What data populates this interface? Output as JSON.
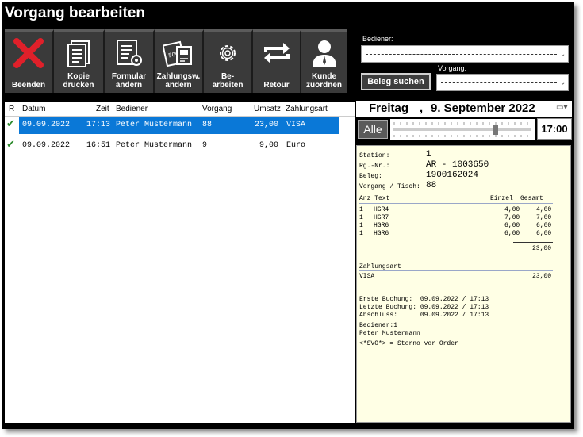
{
  "window": {
    "title": "Vorgang bearbeiten"
  },
  "toolbar": {
    "buttons": [
      {
        "label": "Beenden",
        "icon": "close-x-icon"
      },
      {
        "label": "Kopie\ndrucken",
        "icon": "document-copy-icon"
      },
      {
        "label": "Formular\nändern",
        "icon": "form-gear-icon"
      },
      {
        "label": "Zahlungsw.\nändern",
        "icon": "payment-method-icon"
      },
      {
        "label": "Be-\narbeiten",
        "icon": "gear-icon"
      },
      {
        "label": "Retour",
        "icon": "return-arrows-icon"
      },
      {
        "label": "Kunde\nzuordnen",
        "icon": "customer-icon"
      }
    ]
  },
  "filters": {
    "bediener_label": "Bediener:",
    "vorgang_label": "Vorgang:",
    "beleg_button": "Beleg suchen"
  },
  "table": {
    "headers": {
      "r": "R",
      "datum": "Datum",
      "zeit": "Zeit",
      "bediener": "Bediener",
      "vorgang": "Vorgang",
      "umsatz": "Umsatz",
      "zahlungsart": "Zahlungsart"
    },
    "rows": [
      {
        "datum": "09.09.2022",
        "zeit": "17:13",
        "bediener": "Peter Mustermann",
        "vorgang": "88",
        "umsatz": "23,00",
        "zahlungsart": "VISA"
      },
      {
        "datum": "09.09.2022",
        "zeit": "16:51",
        "bediener": "Peter Mustermann",
        "vorgang": "9",
        "umsatz": "9,00",
        "zahlungsart": "Euro"
      }
    ]
  },
  "date": {
    "weekday": "Freitag",
    "comma": ",",
    "date": "9. September 2022",
    "alle": "Alle",
    "time": "17:00"
  },
  "receipt": {
    "station_label": "Station:",
    "station_value": "1",
    "rgnr_label": "Rg.-Nr.:",
    "rgnr_value": "AR - 1003650",
    "beleg_label": "Beleg:",
    "beleg_value": "1900162024",
    "vorgang_label": "Vorgang / Tisch:",
    "vorgang_value": "88",
    "col_anz_text": "Anz Text",
    "col_einzel": "Einzel",
    "col_gesamt": "Gesamt",
    "items": [
      {
        "anz": "1",
        "text": "HGR4",
        "einzel": "4,00",
        "gesamt": "4,00"
      },
      {
        "anz": "1",
        "text": "HGR7",
        "einzel": "7,00",
        "gesamt": "7,00"
      },
      {
        "anz": "1",
        "text": "HGR6",
        "einzel": "6,00",
        "gesamt": "6,00"
      },
      {
        "anz": "1",
        "text": "HGR6",
        "einzel": "6,00",
        "gesamt": "6,00"
      }
    ],
    "total": "23,00",
    "zahlungsart_label": "Zahlungsart",
    "zahlungsart_value": "VISA",
    "zahlungsart_amount": "23,00",
    "erste_buchung": "Erste Buchung:  09.09.2022 / 17:13",
    "letzte_buchung": "Letzte Buchung: 09.09.2022 / 17:13",
    "abschluss": "Abschluss:      09.09.2022 / 17:13",
    "bediener_line": "Bediener:1",
    "bediener_name": "Peter Mustermann",
    "storno_note": "<*SVO*> = Storno vor Order"
  }
}
